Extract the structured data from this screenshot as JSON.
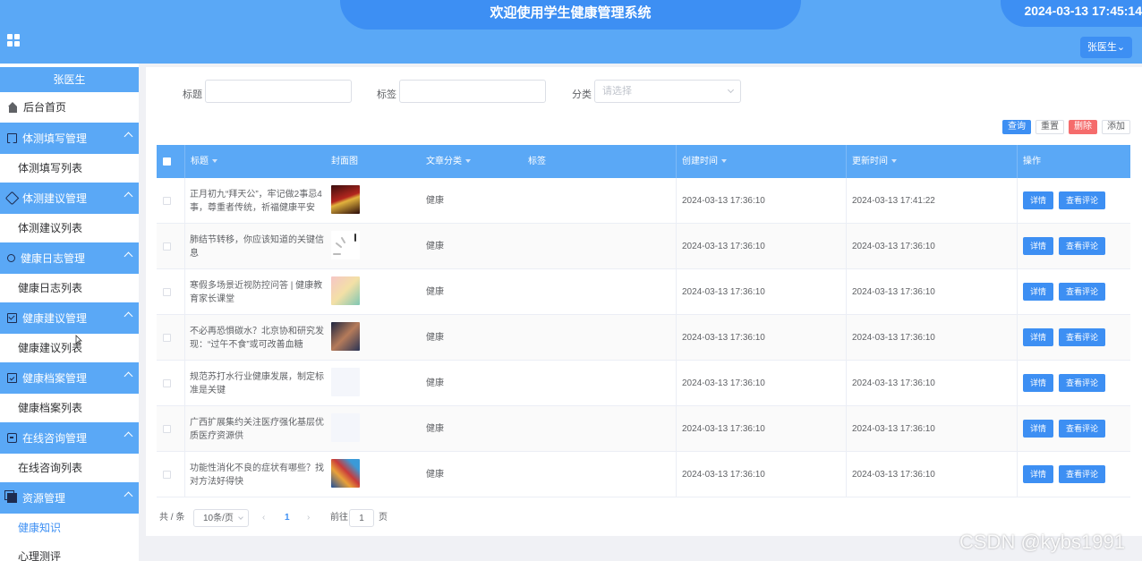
{
  "header": {
    "title": "欢迎使用学生健康管理系统",
    "datetime": "2024-03-13 17:45:14",
    "user_button": "张医生",
    "accent_color": "#5aa8f6",
    "pill_color": "#3d8ff3"
  },
  "sidebar": {
    "user": "张医生",
    "home": "后台首页",
    "groups": [
      {
        "label": "体测填写管理",
        "icon": "bookmark-icon",
        "item": "体测填写列表"
      },
      {
        "label": "体测建议管理",
        "icon": "tag-icon",
        "item": "体测建议列表"
      },
      {
        "label": "健康日志管理",
        "icon": "sun-icon",
        "item": "健康日志列表"
      },
      {
        "label": "健康建议管理",
        "icon": "inbox-icon",
        "item": "健康建议列表"
      },
      {
        "label": "健康档案管理",
        "icon": "clipboard-icon",
        "item": "健康档案列表"
      },
      {
        "label": "在线咨询管理",
        "icon": "chat-icon",
        "item": "在线咨询列表"
      },
      {
        "label": "资源管理",
        "icon": "copy-icon",
        "items": [
          "健康知识",
          "心理测评"
        ]
      }
    ]
  },
  "filters": {
    "title_label": "标题",
    "tag_label": "标签",
    "category_label": "分类",
    "category_placeholder": "请选择"
  },
  "actions": {
    "query": "查询",
    "reset": "重置",
    "delete": "删除",
    "add": "添加"
  },
  "table": {
    "headers": {
      "title": "标题",
      "cover": "封面图",
      "category": "文章分类",
      "tag": "标签",
      "created": "创建时间",
      "updated": "更新时间",
      "ops": "操作"
    },
    "detail_label": "详情",
    "comment_label": "查看评论",
    "rows": [
      {
        "title": "正月初九“拜天公”，牢记做2事忌4事，尊重者传统，祈福健康平安",
        "category": "健康",
        "created": "2024-03-13 17:36:10",
        "updated": "2024-03-13 17:41:22"
      },
      {
        "title": "肺结节转移，你应该知道的关键信息",
        "category": "健康",
        "created": "2024-03-13 17:36:10",
        "updated": "2024-03-13 17:36:10"
      },
      {
        "title": "寒假多场景近视防控问答 | 健康教育家长课堂",
        "category": "健康",
        "created": "2024-03-13 17:36:10",
        "updated": "2024-03-13 17:36:10"
      },
      {
        "title": "不必再恐惧碳水？北京协和研究发现：“过午不食”或可改善血糖",
        "category": "健康",
        "created": "2024-03-13 17:36:10",
        "updated": "2024-03-13 17:36:10"
      },
      {
        "title": "规范苏打水行业健康发展，制定标准是关键",
        "category": "健康",
        "created": "2024-03-13 17:36:10",
        "updated": "2024-03-13 17:36:10"
      },
      {
        "title": "广西扩展集约关注医疗强化基层优质医疗资源供",
        "category": "健康",
        "created": "2024-03-13 17:36:10",
        "updated": "2024-03-13 17:36:10"
      },
      {
        "title": "功能性消化不良的症状有哪些？找对方法好得快",
        "category": "健康",
        "created": "2024-03-13 17:36:10",
        "updated": "2024-03-13 17:36:10"
      }
    ]
  },
  "pager": {
    "total_prefix": "共 / 条",
    "page_size": "10条/页",
    "current_page": "1",
    "goto_prefix": "前往",
    "goto_value": "1",
    "goto_suffix": "页"
  },
  "watermark": "CSDN @kybs1991"
}
